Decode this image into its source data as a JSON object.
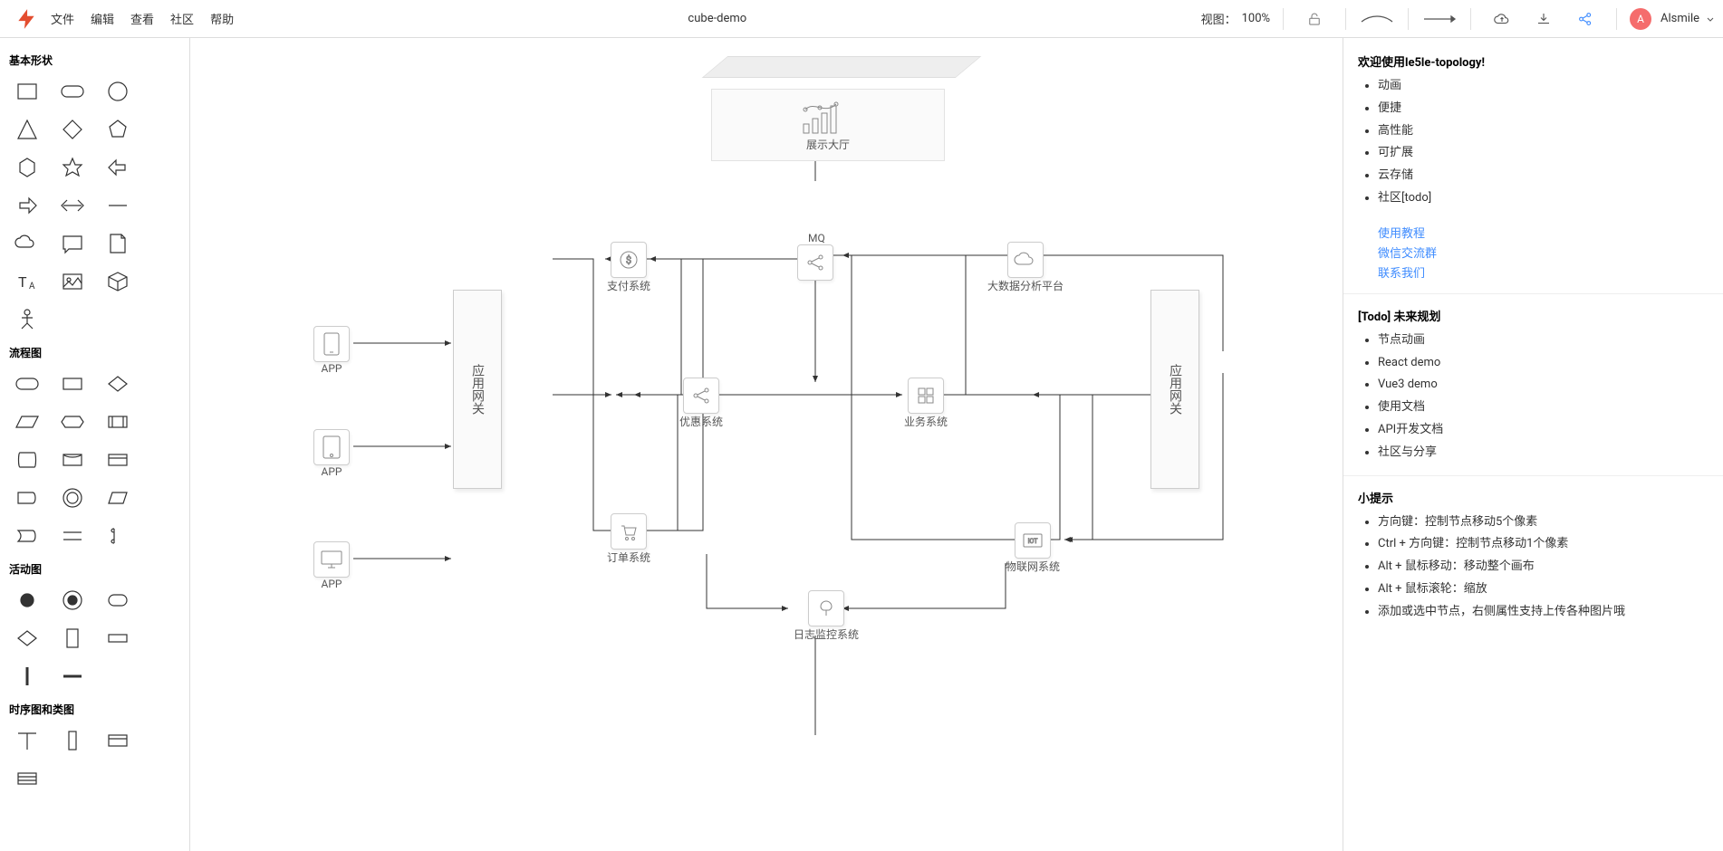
{
  "topbar": {
    "menu": [
      "文件",
      "编辑",
      "查看",
      "社区",
      "帮助"
    ],
    "title": "cube-demo",
    "zoom_label": "视图：",
    "zoom_value": "100%",
    "user_initial": "A",
    "user_name": "Alsmile"
  },
  "palette": {
    "sections": {
      "basic": "基本形状",
      "flow": "流程图",
      "activity": "活动图",
      "seq": "时序图和类图"
    }
  },
  "canvas": {
    "platform_title": "展示大厅",
    "nodes": {
      "app1": "APP",
      "app2": "APP",
      "app3": "APP",
      "gw1": "应用网关",
      "gw2": "应用网关",
      "pay": "支付系统",
      "coupon": "优惠系统",
      "order": "订单系统",
      "mq": "MQ",
      "biz": "业务系统",
      "bigdata": "大数据分析平台",
      "iot": "物联网系统",
      "log": "日志监控系统"
    }
  },
  "rp": {
    "welcome": "欢迎使用le5le-topology!",
    "features": [
      "动画",
      "便捷",
      "高性能",
      "可扩展",
      "云存储",
      "社区[todo]"
    ],
    "links": [
      "使用教程",
      "微信交流群",
      "联系我们"
    ],
    "todo_title": "[Todo] 未来规划",
    "todo": [
      "节点动画",
      "React demo",
      "Vue3 demo",
      "使用文档",
      "API开发文档",
      "社区与分享"
    ],
    "tips_title": "小提示",
    "tips": [
      "方向键：控制节点移动5个像素",
      "Ctrl + 方向键：控制节点移动1个像素",
      "Alt + 鼠标移动：移动整个画布",
      "Alt + 鼠标滚轮：缩放",
      "添加或选中节点，右侧属性支持上传各种图片哦"
    ]
  }
}
